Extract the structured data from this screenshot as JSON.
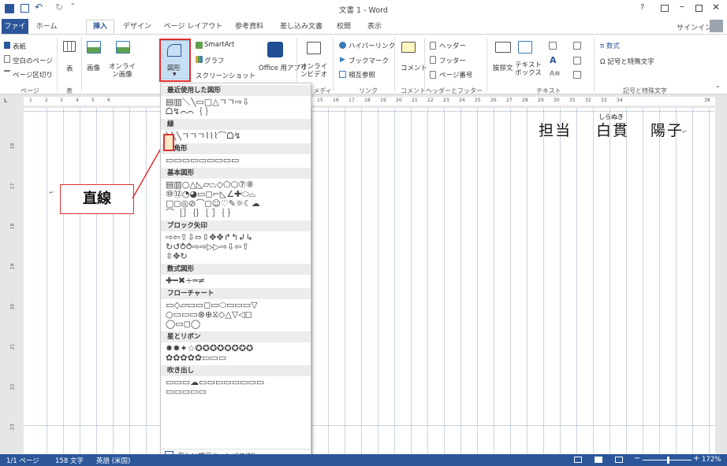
{
  "app": {
    "title": "文書 1 - Word",
    "help": "?",
    "signin": "サインイン"
  },
  "tabs": [
    "ファイル",
    "ホーム",
    "挿入",
    "デザイン",
    "ページ レイアウト",
    "参考資料",
    "差し込み文書",
    "校閲",
    "表示"
  ],
  "ribbon": {
    "pages": {
      "cover": "表紙",
      "blank": "空白のページ",
      "break": "ページ区切り",
      "label": "ページ"
    },
    "tables": {
      "table": "表",
      "label": "表"
    },
    "illustrations": {
      "picture": "画像",
      "online_picture": "オンライン画像",
      "shapes": "図形",
      "smartart": "SmartArt",
      "chart": "グラフ",
      "screenshot": "スクリーンショット"
    },
    "apps": {
      "office": "Office 用アプリ"
    },
    "media": {
      "video": "オンラインビデオ",
      "label": "メディア"
    },
    "links": {
      "hyperlink": "ハイパーリンク",
      "bookmark": "ブックマーク",
      "crossref": "相互参照",
      "label": "リンク"
    },
    "comments": {
      "comment": "コメント",
      "label": "コメント"
    },
    "header_footer": {
      "header": "ヘッダー",
      "footer": "フッター",
      "page_number": "ページ番号",
      "label": "ヘッダーとフッター"
    },
    "text": {
      "greeting": "挨拶文",
      "textbox": "テキストボックス",
      "label": "テキスト"
    },
    "symbols": {
      "equation": "π 数式",
      "symbol": "Ω 記号と特殊文字",
      "label": "記号と特殊文字"
    }
  },
  "ruler_numbers": [
    "1",
    "2",
    "3",
    "4",
    "5",
    "6",
    "15",
    "16",
    "17",
    "18",
    "19",
    "20",
    "21",
    "22",
    "23",
    "24",
    "25",
    "26",
    "27",
    "28",
    "29",
    "30",
    "31",
    "32",
    "33",
    "34",
    "38"
  ],
  "vruler_numbers": [
    "16",
    "17",
    "18",
    "19",
    "20",
    "21",
    "22",
    "23"
  ],
  "document": {
    "text1": "担当",
    "ruby": "しらぬき",
    "text2": "白貫",
    "text3": "陽子"
  },
  "shapes_menu": {
    "sections": [
      {
        "title": "最近使用した図形",
        "rows": [
          "▤▥＼╲▭▢△ㄱㄱ⇨⇩",
          "ᗝ↯⌒⌒｛ ｝"
        ]
      },
      {
        "title": "線",
        "rows": [
          "╲╲╲ㄱㄱㄱ⌇⌇⌇⌒ᗝ↯"
        ]
      },
      {
        "title": "四角形",
        "rows": [
          "▭▭▭▭▭▭▭▭▭"
        ]
      },
      {
        "title": "基本図形",
        "rows": [
          "▤▥○△◺▱⏢◇⬠⬡⑦⑧",
          "⑩⑫◔◕▭◻⌐◺∠✚⬭⌓",
          "▢◻◎⊘⌒◻☺♡✎☼☾☁",
          "⌒［］｛｝［ ］｛ ｝"
        ]
      },
      {
        "title": "ブロック矢印",
        "rows": [
          "⇨⇦⇧⇩⬄⇳✥✥↱↰↲↳",
          "↻↺⥁⥀⇨⇨▷▷⇨⇩⇦⇧",
          "⇳✥↻"
        ]
      },
      {
        "title": "数式図形",
        "rows": [
          "✚━✖÷═≠"
        ]
      },
      {
        "title": "フローチャート",
        "rows": [
          "▭◇▱▭▭◻▭⬭▭▭▭▽",
          "○▭▭▭⊗⊕⧖◇△▽◁◻",
          "◯▭◻◯"
        ]
      },
      {
        "title": "星とリボン",
        "rows": [
          "✸✹✦☆✪✪✪✪✪✪✪✪",
          "✿✿✿✿✿▭▭▭"
        ]
      },
      {
        "title": "吹き出し",
        "rows": [
          "▭▭▭☁▭▭▭▭▭▭▭▭",
          "▭▭▭▭▭"
        ]
      }
    ],
    "footer": "新しい描画キャンバス(N)"
  },
  "callout": "直線",
  "status": {
    "page": "1/1 ページ",
    "words": "158 文字",
    "lang": "英語 (米国)",
    "zoom": "172%"
  },
  "colors": {
    "accent": "#2b579a",
    "highlight": "#e03030"
  }
}
